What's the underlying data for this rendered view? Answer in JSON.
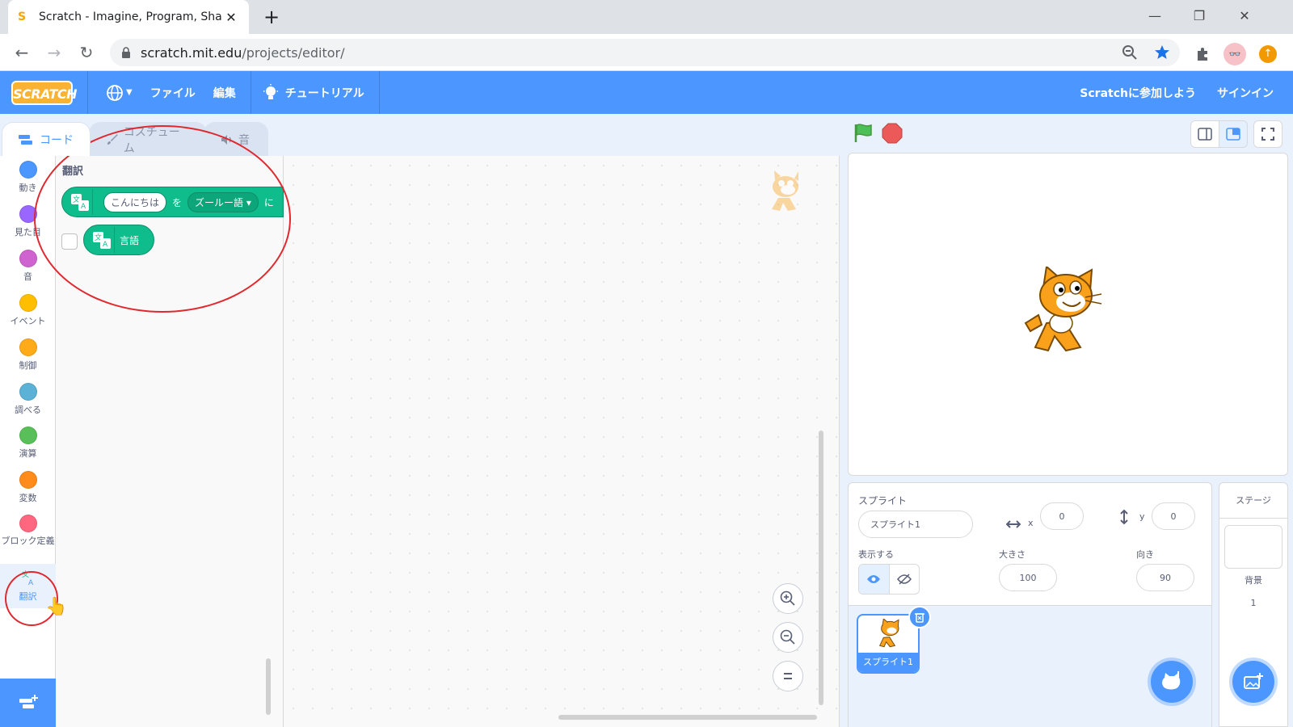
{
  "browser": {
    "tab_title": "Scratch - Imagine, Program, Share",
    "new_tab": "+",
    "url_host": "scratch.mit.edu",
    "url_path": "/projects/editor/",
    "window_controls": [
      "—",
      "❐",
      "✕"
    ]
  },
  "menubar": {
    "logo": "SCRATCH",
    "file": "ファイル",
    "edit": "編集",
    "tutorial": "チュートリアル",
    "join": "Scratchに参加しよう",
    "signin": "サインイン",
    "color": "#4c97ff"
  },
  "tabs": {
    "code": "コード",
    "costumes": "コスチューム",
    "sounds": "音"
  },
  "categories": [
    {
      "label": "動き",
      "color": "#4c97ff"
    },
    {
      "label": "見た目",
      "color": "#9966ff"
    },
    {
      "label": "音",
      "color": "#cf63cf"
    },
    {
      "label": "イベント",
      "color": "#ffbf00"
    },
    {
      "label": "制御",
      "color": "#ffab19"
    },
    {
      "label": "調べる",
      "color": "#5cb1d6"
    },
    {
      "label": "演算",
      "color": "#59c059"
    },
    {
      "label": "変数",
      "color": "#ff8c1a"
    },
    {
      "label": "ブロック定義",
      "color": "#ff6680"
    },
    {
      "label": "翻訳",
      "color": "#0fbd8c"
    }
  ],
  "flyout": {
    "title": "翻訳",
    "translate_block": {
      "text_input": "こんにちは",
      "particle1": "を",
      "language": "ズールー語",
      "particle2": "に"
    },
    "language_block": "言語"
  },
  "sprite_info": {
    "sprite_label": "スプライト",
    "sprite_name": "スプライト1",
    "x_label": "x",
    "x_value": "0",
    "y_label": "y",
    "y_value": "0",
    "show_label": "表示する",
    "size_label": "大きさ",
    "size_value": "100",
    "direction_label": "向き",
    "direction_value": "90"
  },
  "sprite_list": {
    "sprite_name": "スプライト1"
  },
  "stage_pane": {
    "title": "ステージ",
    "backdrop_label": "背景",
    "backdrop_count": "1"
  }
}
